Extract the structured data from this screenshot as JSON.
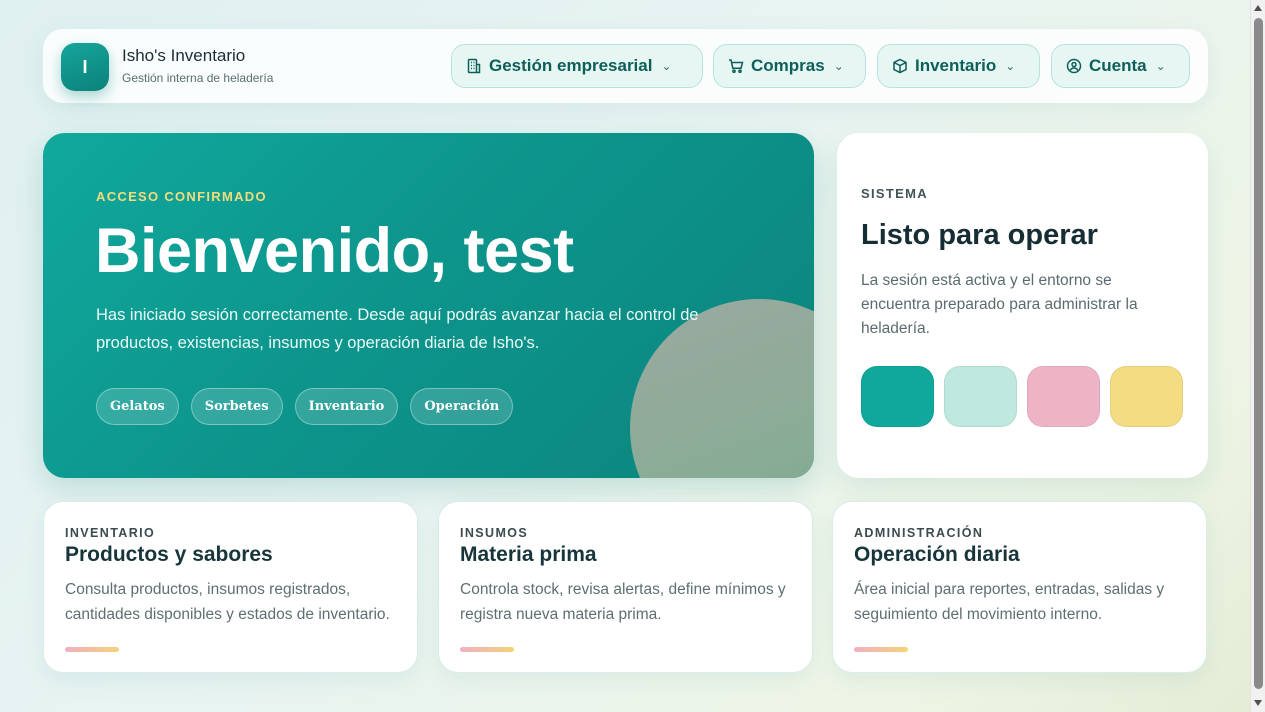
{
  "header": {
    "logo_letter": "I",
    "brand_title": "Isho's Inventario",
    "brand_subtitle": "Gestión interna de heladería",
    "nav": [
      {
        "label": "Gestión empresarial",
        "icon": "building-icon"
      },
      {
        "label": "Compras",
        "icon": "cart-icon"
      },
      {
        "label": "Inventario",
        "icon": "box-icon"
      },
      {
        "label": "Cuenta",
        "icon": "user-circle-icon"
      }
    ]
  },
  "hero": {
    "eyebrow": "ACCESO CONFIRMADO",
    "title": "Bienvenido, test",
    "text": "Has iniciado sesión correctamente. Desde aquí podrás avanzar hacia el control de productos, existencias, insumos y operación diaria de Isho's.",
    "chips": [
      "Gelatos",
      "Sorbetes",
      "Inventario",
      "Operación"
    ]
  },
  "system": {
    "eyebrow": "SISTEMA",
    "title": "Listo para operar",
    "text": "La sesión está activa y el entorno se encuentra preparado para administrar la heladería.",
    "swatches": [
      "#10a89d",
      "#bfe8df",
      "#efb3c6",
      "#f3dc82"
    ]
  },
  "cards": [
    {
      "eyebrow": "INVENTARIO",
      "title": "Productos y sabores",
      "text": "Consulta productos, insumos registrados, cantidades disponibles y estados de inventario."
    },
    {
      "eyebrow": "INSUMOS",
      "title": "Materia prima",
      "text": "Controla stock, revisa alertas, define mínimos y registra nueva materia prima."
    },
    {
      "eyebrow": "ADMINISTRACIÓN",
      "title": "Operación diaria",
      "text": "Área inicial para reportes, entradas, salidas y seguimiento del movimiento interno."
    }
  ],
  "colors": {
    "accent": "#10a89d",
    "accent_dark": "#0b857d",
    "eyebrow_gold": "#f4dc7c"
  }
}
